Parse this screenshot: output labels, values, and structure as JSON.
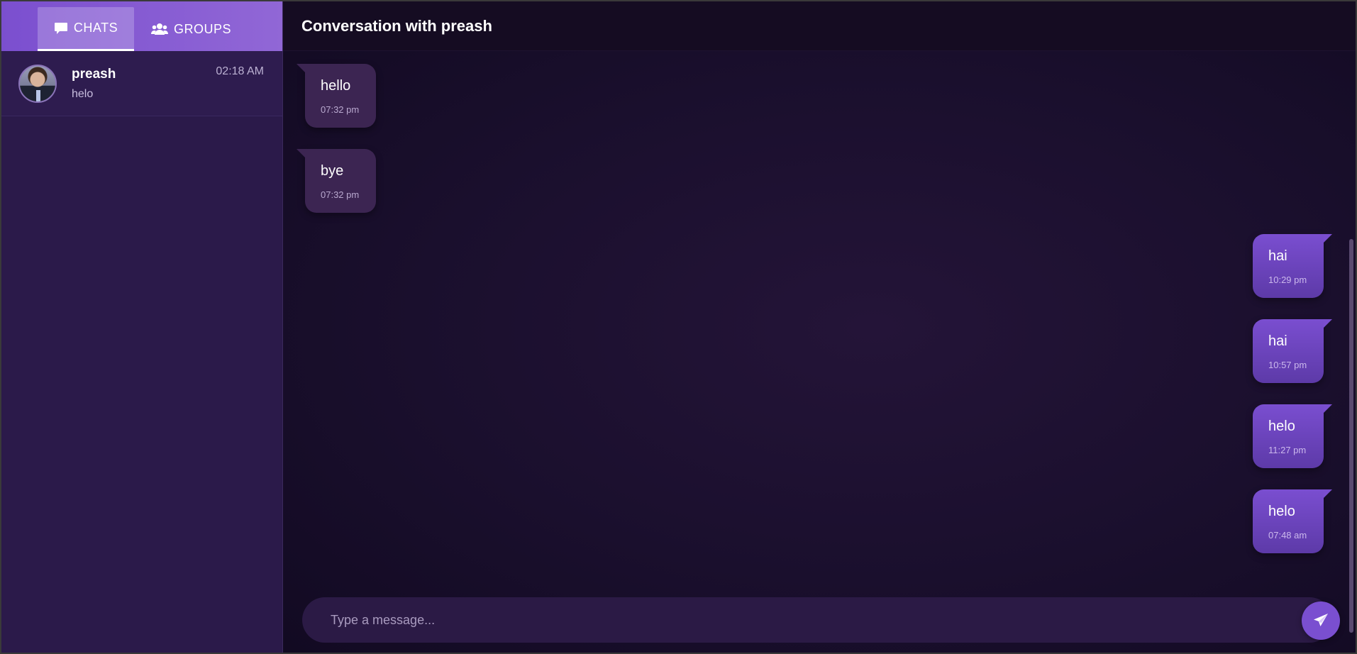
{
  "sidebar": {
    "tabs": [
      {
        "label": "CHATS",
        "icon": "chat-bubble-icon",
        "active": true
      },
      {
        "label": "GROUPS",
        "icon": "users-icon",
        "active": false
      }
    ],
    "chats": [
      {
        "name": "preash",
        "preview": "helo",
        "time": "02:18 AM",
        "avatar": "avatar-photo"
      }
    ]
  },
  "conversation": {
    "title": "Conversation with preash",
    "messages": [
      {
        "direction": "incoming",
        "text": "hello",
        "time": "07:32 pm"
      },
      {
        "direction": "incoming",
        "text": "bye",
        "time": "07:32 pm"
      },
      {
        "direction": "outgoing",
        "text": "hai",
        "time": "10:29 pm"
      },
      {
        "direction": "outgoing",
        "text": "hai",
        "time": "10:57 pm"
      },
      {
        "direction": "outgoing",
        "text": "helo",
        "time": "11:27 pm"
      },
      {
        "direction": "outgoing",
        "text": "helo",
        "time": "07:48 am"
      }
    ]
  },
  "composer": {
    "placeholder": "Type a message...",
    "send_icon": "send-icon"
  },
  "colors": {
    "accent": "#7b4fcf",
    "sidebar_bg": "#2b1a4a",
    "incoming_bubble": "#3c2552",
    "outgoing_bubble": "#7a4ed0"
  }
}
